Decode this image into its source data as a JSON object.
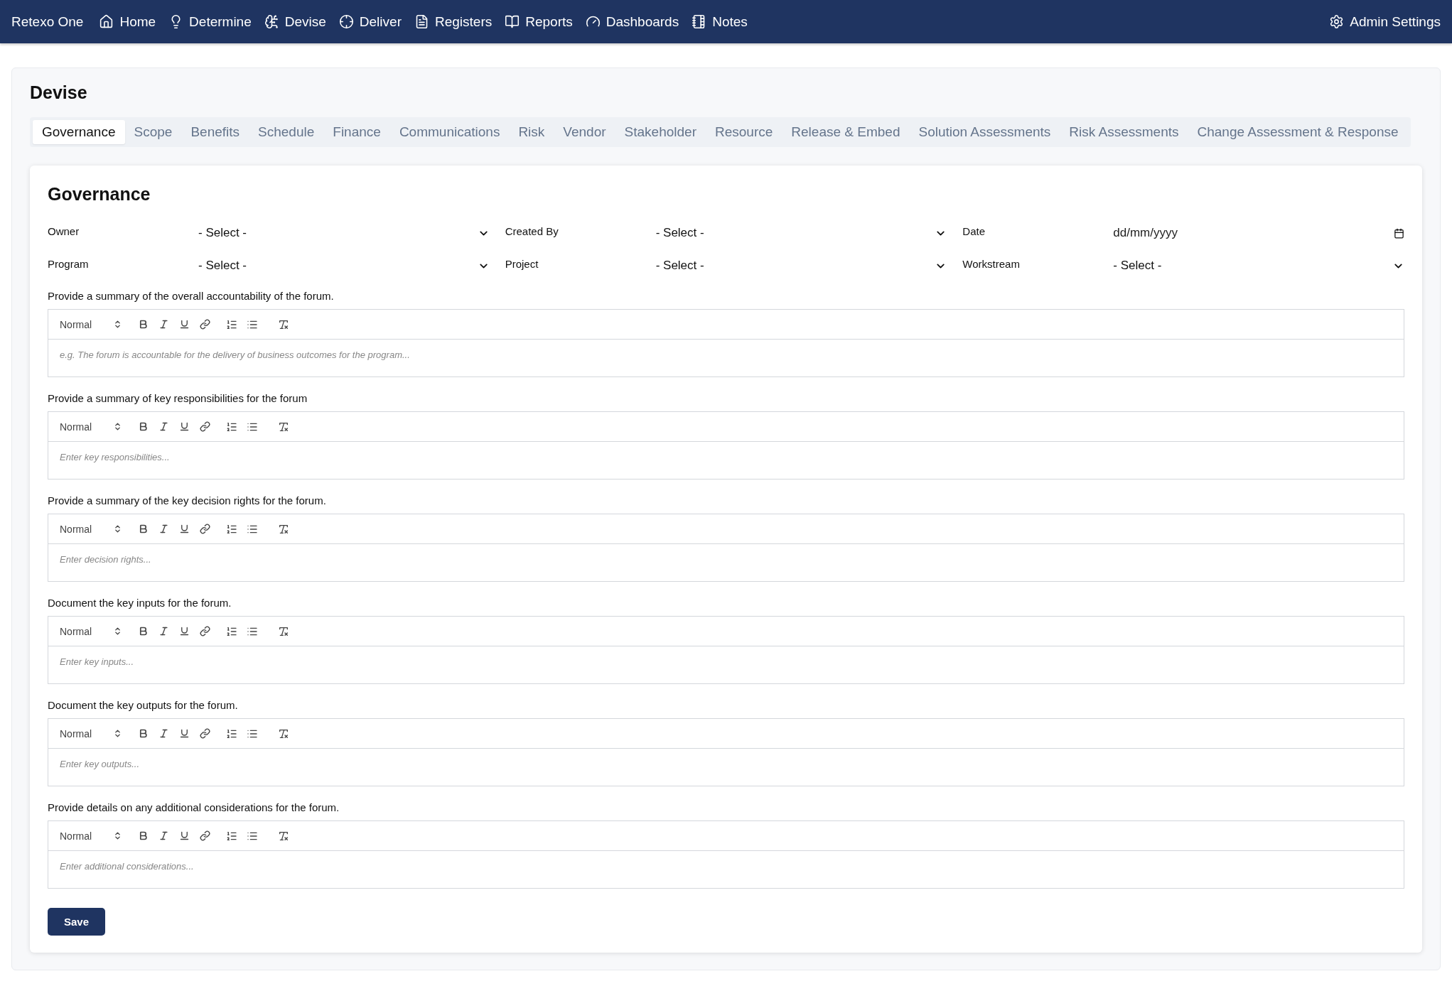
{
  "nav": {
    "brand": "Retexo One",
    "items": [
      {
        "label": "Home"
      },
      {
        "label": "Determine"
      },
      {
        "label": "Devise"
      },
      {
        "label": "Deliver"
      },
      {
        "label": "Registers"
      },
      {
        "label": "Reports"
      },
      {
        "label": "Dashboards"
      },
      {
        "label": "Notes"
      }
    ],
    "admin": "Admin Settings"
  },
  "page_title": "Devise",
  "tabs": [
    {
      "label": "Governance",
      "selected": true
    },
    {
      "label": "Scope",
      "selected": false
    },
    {
      "label": "Benefits",
      "selected": false
    },
    {
      "label": "Schedule",
      "selected": false
    },
    {
      "label": "Finance",
      "selected": false
    },
    {
      "label": "Communications",
      "selected": false
    },
    {
      "label": "Risk",
      "selected": false
    },
    {
      "label": "Vendor",
      "selected": false
    },
    {
      "label": "Stakeholder",
      "selected": false
    },
    {
      "label": "Resource",
      "selected": false
    },
    {
      "label": "Release & Embed",
      "selected": false
    },
    {
      "label": "Solution Assessments",
      "selected": false
    },
    {
      "label": "Risk Assessments",
      "selected": false
    },
    {
      "label": "Change Assessment & Response",
      "selected": false
    }
  ],
  "form": {
    "title": "Governance",
    "fields": [
      {
        "label": "Owner",
        "kind": "select",
        "value": "- Select -"
      },
      {
        "label": "Created By",
        "kind": "select",
        "value": "- Select -"
      },
      {
        "label": "Date",
        "kind": "date",
        "placeholder": "dd/mm/yyyy"
      },
      {
        "label": "Program",
        "kind": "select",
        "value": "- Select -"
      },
      {
        "label": "Project",
        "kind": "select",
        "value": "- Select -"
      },
      {
        "label": "Workstream",
        "kind": "select",
        "value": "- Select -"
      }
    ],
    "editors": [
      {
        "label": "Provide a summary of the overall accountability of the forum.",
        "format": "Normal",
        "placeholder": "e.g. The forum is accountable for the delivery of business outcomes for the program..."
      },
      {
        "label": "Provide a summary of key responsibilities for the forum",
        "format": "Normal",
        "placeholder": "Enter key responsibilities..."
      },
      {
        "label": "Provide a summary of the key decision rights for the forum.",
        "format": "Normal",
        "placeholder": "Enter decision rights..."
      },
      {
        "label": "Document the key inputs for the forum.",
        "format": "Normal",
        "placeholder": "Enter key inputs..."
      },
      {
        "label": "Document the key outputs for the forum.",
        "format": "Normal",
        "placeholder": "Enter key outputs..."
      },
      {
        "label": "Provide details on any additional considerations for the forum.",
        "format": "Normal",
        "placeholder": "Enter additional considerations..."
      }
    ],
    "save": "Save"
  }
}
